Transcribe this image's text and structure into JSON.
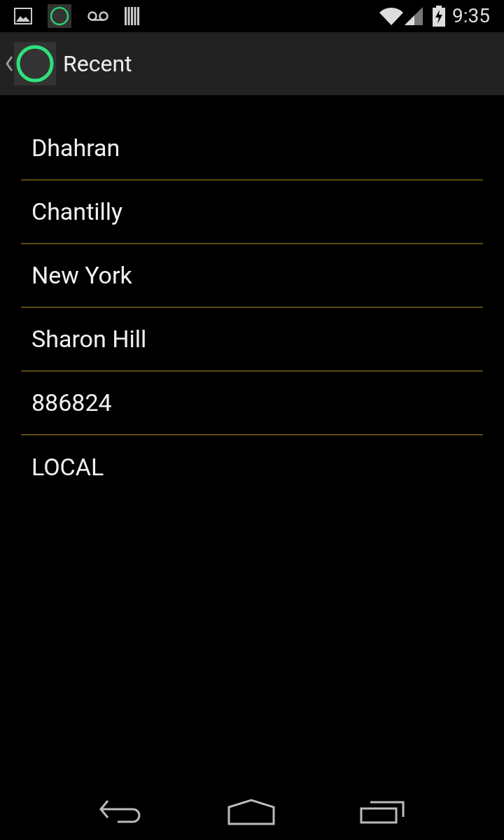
{
  "status_bar": {
    "time": "9:35"
  },
  "action_bar": {
    "title": "Recent"
  },
  "items": [
    {
      "label": "Dhahran"
    },
    {
      "label": "Chantilly"
    },
    {
      "label": "New York"
    },
    {
      "label": "Sharon Hill"
    },
    {
      "label": "886824"
    },
    {
      "label": "LOCAL"
    }
  ]
}
